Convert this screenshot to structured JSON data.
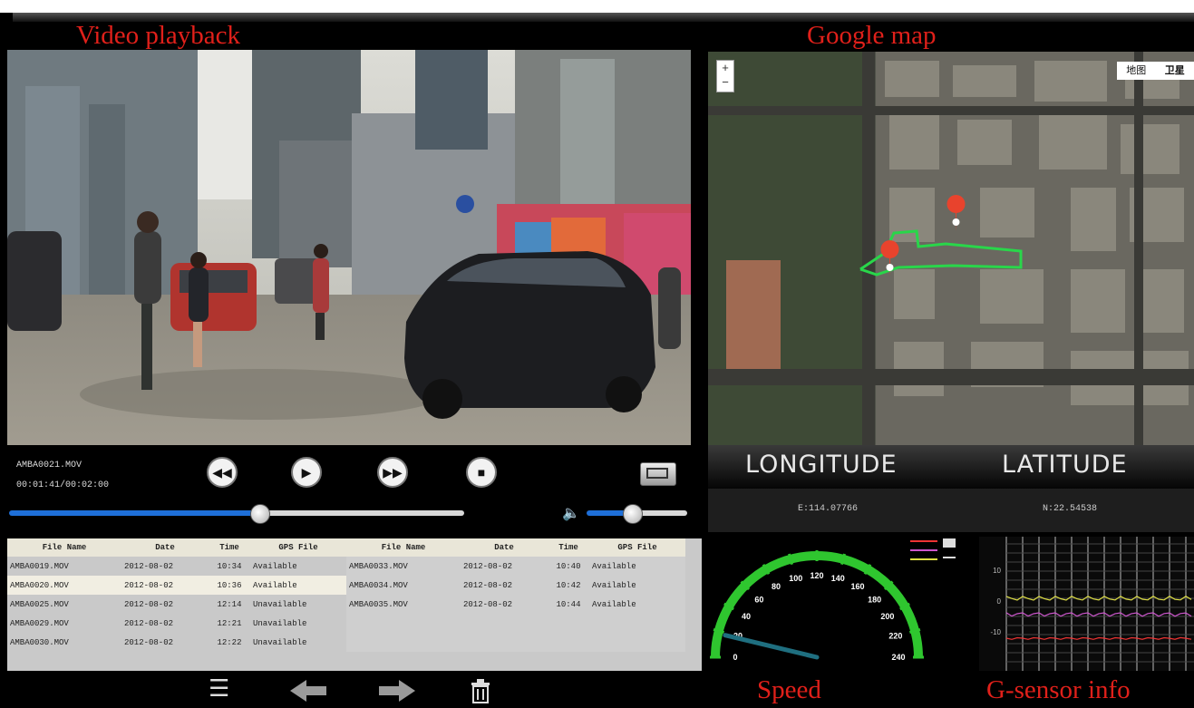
{
  "titles": {
    "video": "Video playback",
    "map": "Google map",
    "speed": "Speed",
    "gsensor": "G-sensor info"
  },
  "player": {
    "filename": "AMBA0021.MOV",
    "timecode": "00:01:41/00:02:00",
    "progress": 0.55,
    "volume": 0.45
  },
  "file_table": {
    "headers": [
      "File Name",
      "Date",
      "Time",
      "GPS File"
    ],
    "rows_left": [
      [
        "AMBA0019.MOV",
        "2012-08-02",
        "10:34",
        "Available"
      ],
      [
        "AMBA0020.MOV",
        "2012-08-02",
        "10:36",
        "Available"
      ],
      [
        "AMBA0025.MOV",
        "2012-08-02",
        "12:14",
        "Unavailable"
      ],
      [
        "AMBA0029.MOV",
        "2012-08-02",
        "12:21",
        "Unavailable"
      ],
      [
        "AMBA0030.MOV",
        "2012-08-02",
        "12:22",
        "Unavailable"
      ]
    ],
    "rows_right": [
      [
        "AMBA0033.MOV",
        "2012-08-02",
        "10:40",
        "Available"
      ],
      [
        "AMBA0034.MOV",
        "2012-08-02",
        "10:42",
        "Available"
      ],
      [
        "AMBA0035.MOV",
        "2012-08-02",
        "10:44",
        "Available"
      ]
    ],
    "selected_row": 1
  },
  "map": {
    "zoom_in": "+",
    "zoom_out": "−",
    "type_map": "地图",
    "type_satellite": "卫星"
  },
  "gps": {
    "longitude_label": "LONGITUDE",
    "latitude_label": "LATITUDE",
    "longitude_value": "E:114.07766",
    "latitude_value": "N:22.54538"
  },
  "speedometer": {
    "ticks": [
      "0",
      "20",
      "40",
      "60",
      "80",
      "100",
      "120",
      "140",
      "160",
      "180",
      "200",
      "220",
      "240"
    ],
    "needle_value": 18
  },
  "gsensor": {
    "y_labels": [
      "10",
      "0",
      "-10"
    ]
  },
  "icons": {
    "rewind": "rewind-icon",
    "play": "play-icon",
    "forward": "fast-forward-icon",
    "stop": "stop-icon",
    "fullscreen": "fullscreen-icon",
    "volume": "volume-icon",
    "menu": "menu-icon",
    "prev": "arrow-left-icon",
    "next": "arrow-right-icon",
    "delete": "trash-icon"
  },
  "colors": {
    "title_red": "#e0201a",
    "track_blue": "#1e6fd8",
    "speed_green": "#2fc62f",
    "route_green": "#29d64a",
    "pin_red": "#e8432d"
  }
}
